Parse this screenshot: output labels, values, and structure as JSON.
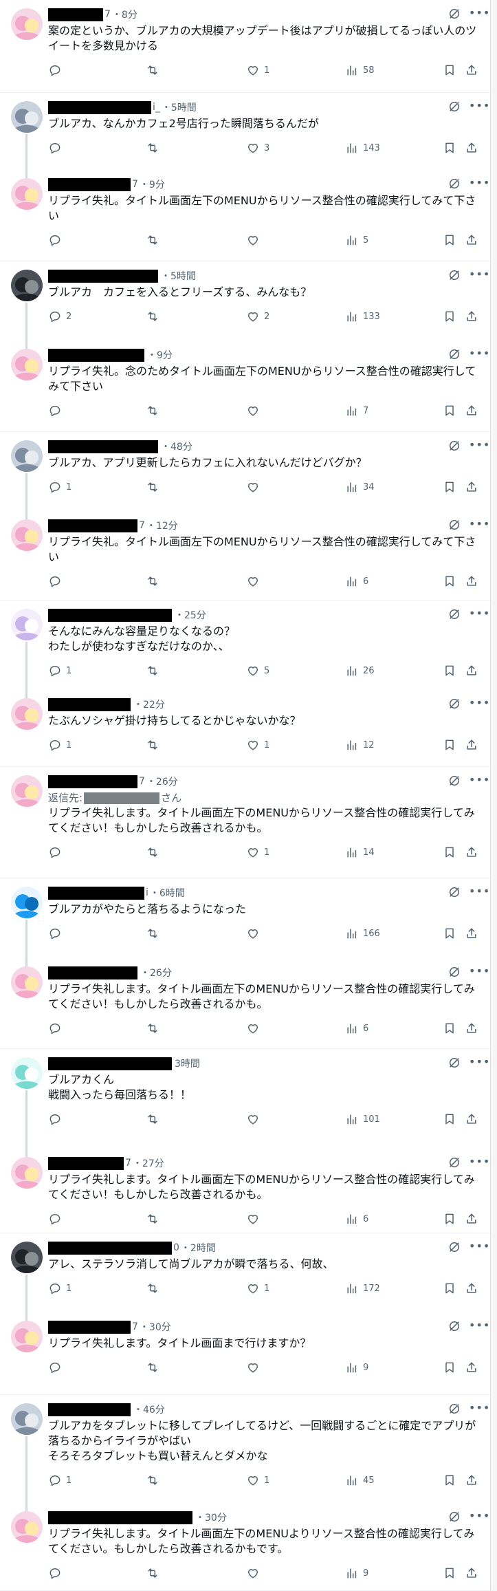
{
  "tweets": [
    {
      "handle_frag": "7",
      "time": "・8分",
      "text": "案の定というか、ブルアカの大規模アップデート後はアプリが破損してるっぽい人のツイートを多数見かける",
      "replies": "",
      "retweets": "",
      "likes": "1",
      "views": "58",
      "avatar": "pink"
    },
    {
      "handle_frag": "i_",
      "time": "・5時間",
      "text": "ブルアカ、なんかカフェ2号店行った瞬間落ちるんだが",
      "replies": "",
      "retweets": "",
      "likes": "3",
      "views": "143",
      "avatar": "grey"
    },
    {
      "handle_frag": "7",
      "time": "・9分",
      "text": "リプライ失礼。タイトル画面左下のMENUからリソース整合性の確認実行してみて下さい",
      "replies": "",
      "retweets": "",
      "likes": "",
      "views": "5",
      "avatar": "pink"
    },
    {
      "handle_frag": "",
      "time": "・5時間",
      "text": "ブルアカ　カフェを入るとフリーズする、みんなも？",
      "replies": "2",
      "retweets": "",
      "likes": "2",
      "views": "133",
      "avatar": "dark"
    },
    {
      "handle_frag": "",
      "time": "・9分",
      "text": "リプライ失礼。念のためタイトル画面左下のMENUからリソース整合性の確認実行してみて下さい",
      "replies": "",
      "retweets": "",
      "likes": "",
      "views": "7",
      "avatar": "pink"
    },
    {
      "handle_frag": "",
      "time": "・48分",
      "text": "ブルアカ、アプリ更新したらカフェに入れないんだけどバグか？",
      "replies": "1",
      "retweets": "",
      "likes": "",
      "views": "34",
      "avatar": "grey"
    },
    {
      "handle_frag": "7",
      "time": "・12分",
      "text": "リプライ失礼。タイトル画面左下のMENUからリソース整合性の確認実行してみて下さい",
      "replies": "",
      "retweets": "",
      "likes": "",
      "views": "6",
      "avatar": "pink"
    },
    {
      "handle_frag": "",
      "time": "・25分",
      "text": "そんなにみんな容量足りなくなるの？\nわたしが使わなすぎなだけなのか、、",
      "replies": "1",
      "retweets": "",
      "likes": "5",
      "views": "26",
      "avatar": "light"
    },
    {
      "handle_frag": "",
      "time": "・22分",
      "text": "たぶんソシャゲ掛け持ちしてるとかじゃないかな？",
      "replies": "1",
      "retweets": "",
      "likes": "1",
      "views": "12",
      "avatar": "pink"
    },
    {
      "handle_frag": "7",
      "time": "・26分",
      "replying_prefix": "返信先:",
      "replying_suffix": "さん",
      "text": "リプライ失礼します。タイトル画面左下のMENUからリソース整合性の確認実行してみてください！もしかしたら改善されるかも。",
      "replies": "",
      "retweets": "",
      "likes": "1",
      "views": "14",
      "avatar": "pink"
    },
    {
      "handle_frag": "i",
      "time": "・6時間",
      "text": "ブルアカがやたらと落ちるようになった",
      "replies": "",
      "retweets": "",
      "likes": "",
      "views": "166",
      "avatar": "blue"
    },
    {
      "handle_frag": "",
      "time": "・26分",
      "text": "リプライ失礼します。タイトル画面左下のMENUからリソース整合性の確認実行してみてください！もしかしたら改善されるかも。",
      "replies": "",
      "retweets": "",
      "likes": "",
      "views": "6",
      "avatar": "pink"
    },
    {
      "handle_frag": "",
      "time": "3時間",
      "text": "ブルアカくん\n戦闘入ったら毎回落ちる！！",
      "replies": "",
      "retweets": "",
      "likes": "",
      "views": "101",
      "avatar": "teal"
    },
    {
      "handle_frag": "7",
      "time": "・27分",
      "text": "リプライ失礼します。タイトル画面左下のMENUからリソース整合性の確認実行してみてください！もしかしたら改善されるかも。",
      "replies": "",
      "retweets": "",
      "likes": "",
      "views": "6",
      "avatar": "pink"
    },
    {
      "handle_frag": "0",
      "time": "・2時間",
      "text": "アレ、ステラソラ消して尚ブルアカが瞬で落ちる、何故、",
      "replies": "1",
      "retweets": "",
      "likes": "1",
      "views": "172",
      "avatar": "dark"
    },
    {
      "handle_frag": "7",
      "time": "・30分",
      "text": "リプライ失礼します。タイトル画面まで行けますか？",
      "replies": "",
      "retweets": "",
      "likes": "",
      "views": "9",
      "avatar": "pink"
    },
    {
      "handle_frag": "",
      "time": "・46分",
      "text": "ブルアカをタブレットに移してプレイしてるけど、一回戦闘するごとに確定でアプリが落ちるからイライラがやばい\nそろそろタブレットも買い替えんとダメかな",
      "replies": "1",
      "retweets": "",
      "likes": "1",
      "views": "45",
      "avatar": "grey"
    },
    {
      "handle_frag": "",
      "time": "・30分",
      "text": "リプライ失礼します。タイトル画面左下のMENUよりリソース整合性の確認実行してみてください。もしかしたら改善されるかもです。",
      "replies": "",
      "retweets": "",
      "likes": "",
      "views": "9",
      "avatar": "pink"
    }
  ],
  "colors": {
    "muted": "#536471",
    "accent": "#1d9bf0",
    "divider": "#eff3f4",
    "thread": "#cfd9de"
  }
}
